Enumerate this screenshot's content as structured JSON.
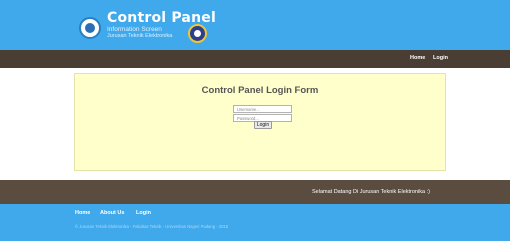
{
  "brand": {
    "title": "Control Panel",
    "subtitle": "Information Screen",
    "subtitle2": "Jurusan Teknik Elektronika"
  },
  "topnav": {
    "home": "Home",
    "login": "Login"
  },
  "form": {
    "title": "Control Panel Login Form",
    "username_placeholder": "Username...",
    "password_placeholder": "Password...",
    "submit_label": "Login"
  },
  "marquee": {
    "text": "Selamat Datang Di Jurusan Teknik Elektronika :)"
  },
  "footer": {
    "home": "Home",
    "about": "About Us",
    "login": "Login",
    "copyright": "© Jurusan Teknik Elektronika - Fakultas Teknik - Universitas Negeri Padang - 2015"
  },
  "colors": {
    "header_bg": "#3fa9ec",
    "nav_bg": "#4a3e34",
    "panel_bg": "#ffffcc"
  },
  "icons": {
    "logo_left": "tut-wuri-handayani-emblem-icon",
    "logo_right": "university-seal-icon"
  }
}
